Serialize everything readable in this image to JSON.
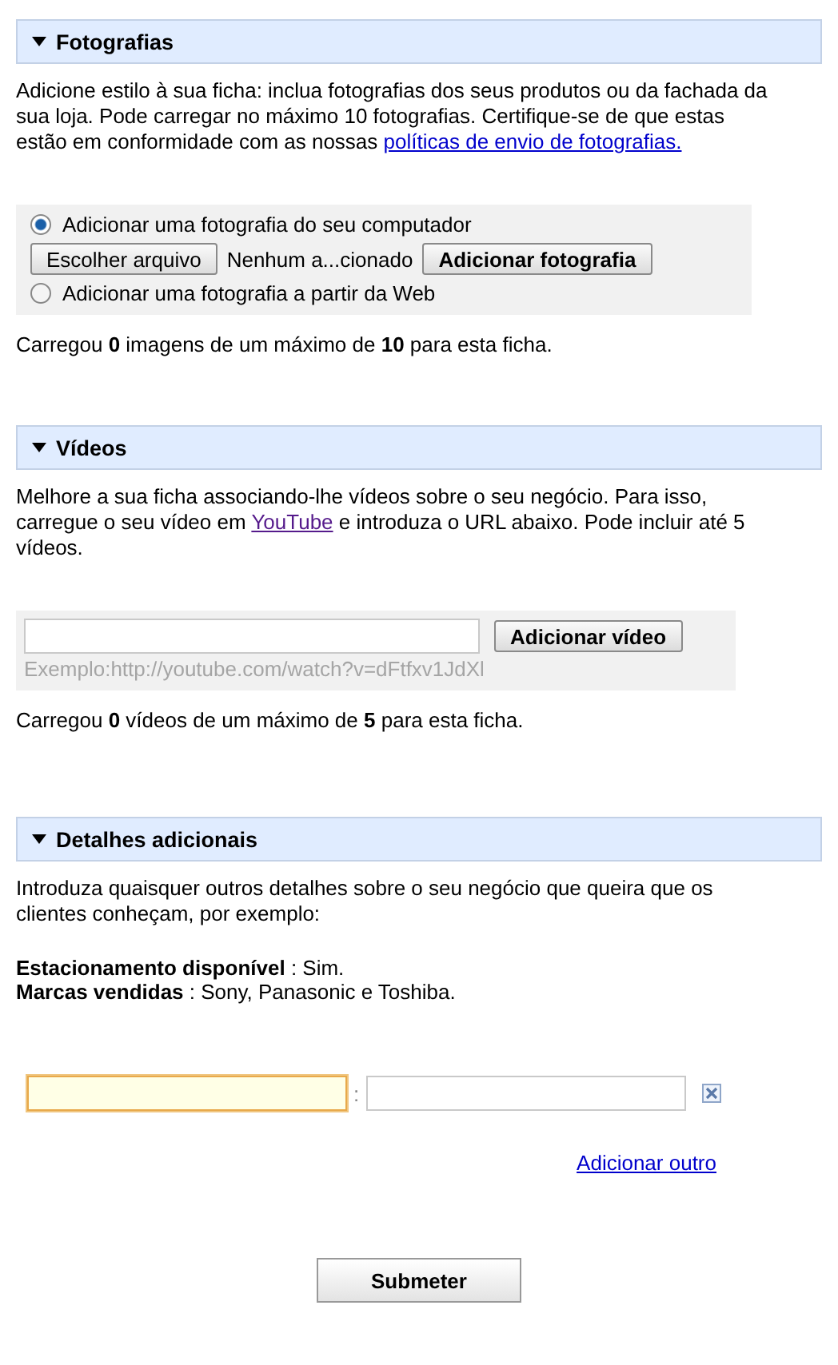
{
  "photos": {
    "title": "Fotografias",
    "expanded": true,
    "intro": {
      "before": "Adicione estilo à sua ficha: inclua fotografias dos seus produtos ou da fachada da sua loja. Pode carregar no máximo 10 fotografias. Certifique-se de que estas estão em conformidade com as nossas ",
      "link": "políticas de envio de fotografias."
    },
    "options": [
      {
        "label": "Adicionar uma fotografia do seu computador",
        "selected": true
      },
      {
        "label": "Adicionar uma fotografia a partir da Web",
        "selected": false
      }
    ],
    "choose_button": "Escolher arquivo",
    "file_name": "Nenhum a...cionado",
    "add_button": "Adicionar fotografia",
    "count": "Carregou **0** imagens de um máximo de **10** para esta ficha."
  },
  "videos": {
    "title": "Vídeos",
    "expanded": true,
    "intro": {
      "before": "Melhore a sua ficha associando-lhe vídeos sobre o seu negócio. Para isso, carregue o seu vídeo em ",
      "link": "YouTube",
      "after": " e introduza o URL abaixo. Pode incluir até 5 vídeos."
    },
    "add_button": "Adicionar vídeo",
    "example": "Exemplo:http://youtube.com/watch?v=dFtfxv1JdXl",
    "count": "Carregou **0** vídeos de um máximo de **5** para esta ficha."
  },
  "details": {
    "title": "Detalhes adicionais",
    "expanded": true,
    "intro": "Introduza quaisquer outros detalhes sobre o seu negócio que queira que os clientes conheçam, por exemplo:",
    "examples": [
      "**Estacionamento disponível** : Sim.",
      "**Marcas vendidas** : Sony, Panasonic e Toshiba."
    ],
    "rows": [
      {
        "separator": ":",
        "focused": true
      }
    ],
    "add_link": "Adicionar outro"
  },
  "submit": "Submeter"
}
